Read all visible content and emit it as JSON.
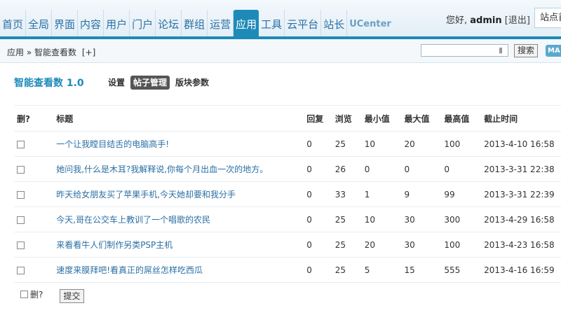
{
  "nav": {
    "items": [
      "首页",
      "全局",
      "界面",
      "内容",
      "用户",
      "门户",
      "论坛",
      "群组",
      "运营",
      "应用",
      "工具",
      "云平台",
      "站长",
      "UCenter"
    ],
    "active": "应用"
  },
  "user": {
    "greeting": "您好,",
    "name": "admin",
    "logout": "[退出]",
    "site_label": "站点首"
  },
  "breadcrumb": {
    "root": "应用",
    "sep": "»",
    "current": "智能查看数",
    "add": "[+]"
  },
  "search": {
    "value": "",
    "button": "搜索",
    "map_button": "MA"
  },
  "page": {
    "title": "智能查看数 1.0",
    "tabs": [
      {
        "label": "设置",
        "active": false
      },
      {
        "label": "帖子管理",
        "active": true
      },
      {
        "label": "版块参数",
        "active": false
      }
    ]
  },
  "table": {
    "headers": [
      "删?",
      "标题",
      "回复",
      "浏览",
      "最小值",
      "最大值",
      "最高值",
      "截止时间"
    ],
    "rows": [
      {
        "title": "一个让我瞠目结舌的电脑高手!",
        "replies": "0",
        "views": "25",
        "min": "10",
        "max": "20",
        "peak": "100",
        "deadline": "2013-4-10 16:58"
      },
      {
        "title": "她问我,什么是木耳?我解释说,你每个月出血一次的地方。",
        "replies": "0",
        "views": "26",
        "min": "0",
        "max": "0",
        "peak": "0",
        "deadline": "2013-3-31 22:38"
      },
      {
        "title": "昨天给女朋友买了苹果手机,今天她却要和我分手",
        "replies": "0",
        "views": "33",
        "min": "1",
        "max": "9",
        "peak": "99",
        "deadline": "2013-3-31 22:39"
      },
      {
        "title": "今天,哥在公交车上教训了一个唱歌的农民",
        "replies": "0",
        "views": "25",
        "min": "10",
        "max": "30",
        "peak": "300",
        "deadline": "2013-4-29 16:58"
      },
      {
        "title": "来看看牛人们制作另类PSP主机",
        "replies": "0",
        "views": "25",
        "min": "20",
        "max": "30",
        "peak": "100",
        "deadline": "2013-4-23 16:58"
      },
      {
        "title": "速度来膜拜吧!看真正的屌丝怎样吃西瓜",
        "replies": "0",
        "views": "25",
        "min": "5",
        "max": "15",
        "peak": "555",
        "deadline": "2013-4-16 16:59"
      }
    ]
  },
  "footer": {
    "select_all_label": "删?",
    "submit": "提交"
  }
}
